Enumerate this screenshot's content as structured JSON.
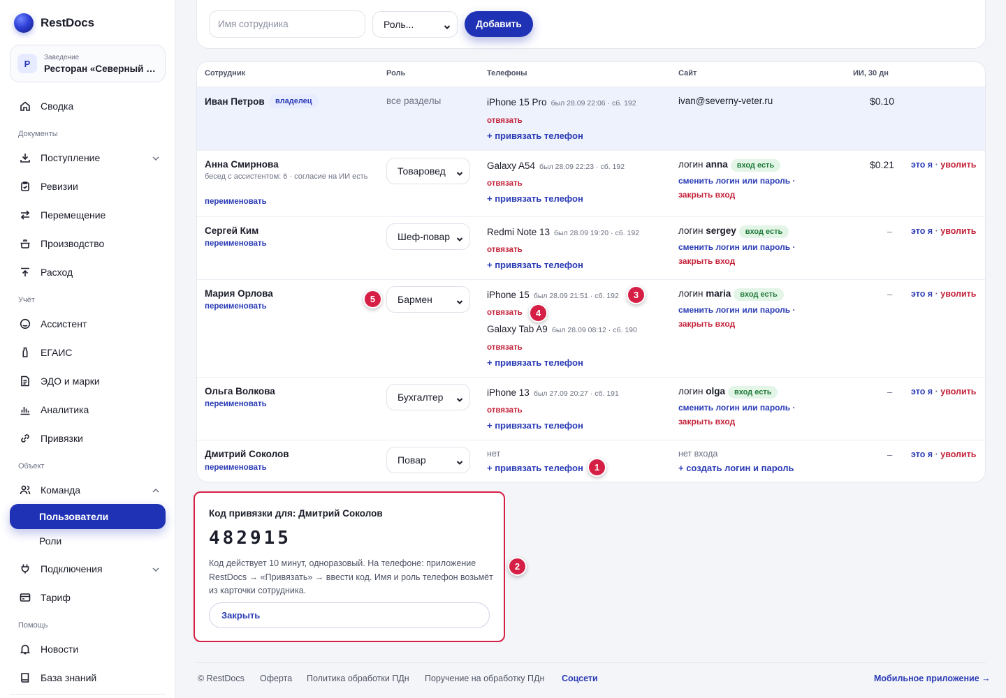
{
  "brand": {
    "name": "RestDocs"
  },
  "venue": {
    "badge": "Р",
    "label": "Заведение",
    "name": "Ресторан «Северный ветер»"
  },
  "nav": {
    "summary": "Сводка",
    "section_docs": "Документы",
    "income": "Поступление",
    "audits": "Ревизии",
    "transfer": "Перемещение",
    "production": "Производство",
    "expense": "Расход",
    "section_accounting": "Учёт",
    "assistant": "Ассистент",
    "egais": "ЕГАИС",
    "edo": "ЭДО и марки",
    "analytics": "Аналитика",
    "bindings": "Привязки",
    "section_object": "Объект",
    "team": "Команда",
    "users": "Пользователи",
    "roles": "Роли",
    "connections": "Подключения",
    "tariff": "Тариф",
    "section_help": "Помощь",
    "news": "Новости",
    "kb": "База знаний"
  },
  "form": {
    "name_placeholder": "Имя сотрудника",
    "role_placeholder": "Роль...",
    "add_label": "Добавить"
  },
  "table": {
    "headers": {
      "employee": "Сотрудник",
      "role": "Роль",
      "phones": "Телефоны",
      "site": "Сайт",
      "ai": "ИИ, 30 дн"
    },
    "owner_badge": "владелец",
    "rename": "переименовать",
    "unlink": "отвязать",
    "bind_phone": "+ привязать телефон",
    "login_prefix": "логин",
    "login_badge": "вход есть",
    "change_login": "сменить логин или пароль ·",
    "close_login": "закрыть вход",
    "action_me": "это я",
    "action_sep": "·",
    "action_fire": "уволить",
    "dash": "–",
    "rows": [
      {
        "name": "Иван Петров",
        "role": "все разделы",
        "phone1": "iPhone 15 Pro",
        "phone1_info": "был 28.09 22:06 · сб. 192",
        "site": "ivan@severny-veter.ru",
        "cost": "$0.10"
      },
      {
        "name": "Анна Смирнова",
        "meta": "бесед с ассистентом: 6 · согласие на ИИ есть",
        "role": "Товаровед",
        "phone1": "Galaxy A54",
        "phone1_info": "был 28.09 22:23 · сб. 192",
        "login": "anna",
        "cost": "$0.21"
      },
      {
        "name": "Сергей Ким",
        "role": "Шеф-повар",
        "phone1": "Redmi Note 13",
        "phone1_info": "был 28.09 19:20 · сб. 192",
        "login": "sergey"
      },
      {
        "name": "Мария Орлова",
        "role": "Бармен",
        "phone1": "iPhone 15",
        "phone1_info": "был 28.09 21:51 · сб. 192",
        "phone2": "Galaxy Tab A9",
        "phone2_info": "был 28.09 08:12 · сб. 190",
        "login": "maria"
      },
      {
        "name": "Ольга Волкова",
        "role": "Бухгалтер",
        "phone1": "iPhone 13",
        "phone1_info": "был 27.09 20:27 · сб. 191",
        "login": "olga"
      },
      {
        "name": "Дмитрий Соколов",
        "role": "Повар",
        "phone_none": "нет",
        "site_none": "нет входа",
        "create_login": "+ создать логин и пароль"
      }
    ]
  },
  "markers": [
    "1",
    "2",
    "3",
    "4",
    "5"
  ],
  "code_card": {
    "title": "Код привязки для: Дмитрий Соколов",
    "code": "482915",
    "desc": "Код действует 10 минут, одноразовый. На телефоне: приложение RestDocs → «Привязать» → ввести код. Имя и роль телефон возьмёт из карточки сотрудника.",
    "close_label": "Закрыть"
  },
  "footer": {
    "copyright": "© RestDocs",
    "offer": "Оферта",
    "privacy": "Политика обработки ПДн",
    "instruction": "Поручение на обработку ПДн",
    "socials": "Соцсети",
    "mobile": "Мобильное приложение →"
  }
}
